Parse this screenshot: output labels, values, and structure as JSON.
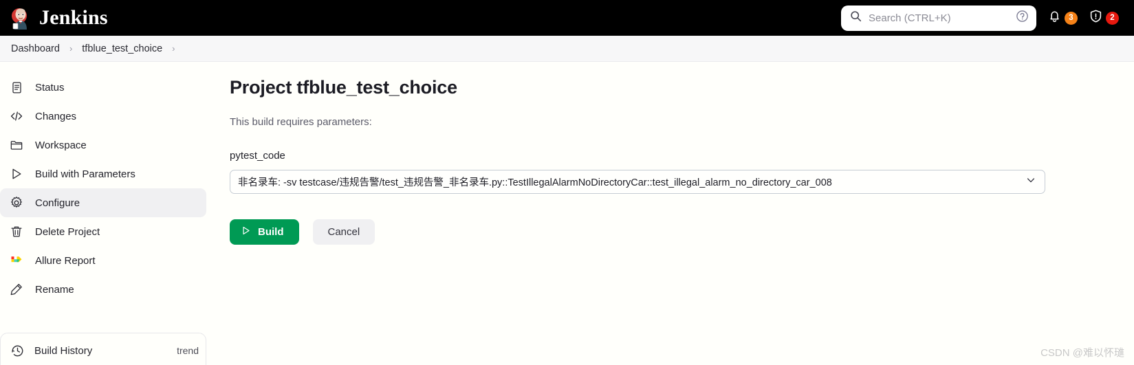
{
  "topbar": {
    "brand": "Jenkins",
    "logo_icon": "jenkins-butler-logo",
    "search": {
      "icon": "search-icon",
      "placeholder": "Search (CTRL+K)",
      "help_icon": "question-circle-icon"
    },
    "notifications": {
      "icon": "bell-icon",
      "count": "3",
      "color": "#f58218"
    },
    "security": {
      "icon": "shield-exclamation-icon",
      "count": "2",
      "color": "#e8190f"
    }
  },
  "breadcrumb": {
    "items": [
      {
        "label": "Dashboard"
      },
      {
        "label": "tfblue_test_choice"
      }
    ],
    "separator": "›"
  },
  "sidebar": {
    "items": [
      {
        "label": "Status",
        "icon": "document-icon",
        "active": false
      },
      {
        "label": "Changes",
        "icon": "code-brackets-icon",
        "active": false
      },
      {
        "label": "Workspace",
        "icon": "folder-icon",
        "active": false
      },
      {
        "label": "Build with Parameters",
        "icon": "play-triangle-icon",
        "active": false
      },
      {
        "label": "Configure",
        "icon": "gear-icon",
        "active": true
      },
      {
        "label": "Delete Project",
        "icon": "trash-icon",
        "active": false
      },
      {
        "label": "Allure Report",
        "icon": "allure-logo-icon",
        "active": false
      },
      {
        "label": "Rename",
        "icon": "pencil-icon",
        "active": false
      }
    ],
    "build_history": {
      "label": "Build History",
      "icon": "clock-history-icon",
      "trend": "trend",
      "trend_suffix": "⌄⌄"
    }
  },
  "main": {
    "title": "Project tfblue_test_choice",
    "requires_parameters_text": "This build requires parameters:",
    "parameter": {
      "name": "pytest_code",
      "selected_value": "非名录车: -sv testcase/违规告警/test_违规告警_非名录车.py::TestIllegalAlarmNoDirectoryCar::test_illegal_alarm_no_directory_car_008",
      "chevron_icon": "chevron-down-icon"
    },
    "buttons": {
      "build": {
        "label": "Build",
        "icon": "play-triangle-icon",
        "color": "#009a54"
      },
      "cancel": {
        "label": "Cancel"
      }
    }
  },
  "watermark": "CSDN @难以怀璡"
}
